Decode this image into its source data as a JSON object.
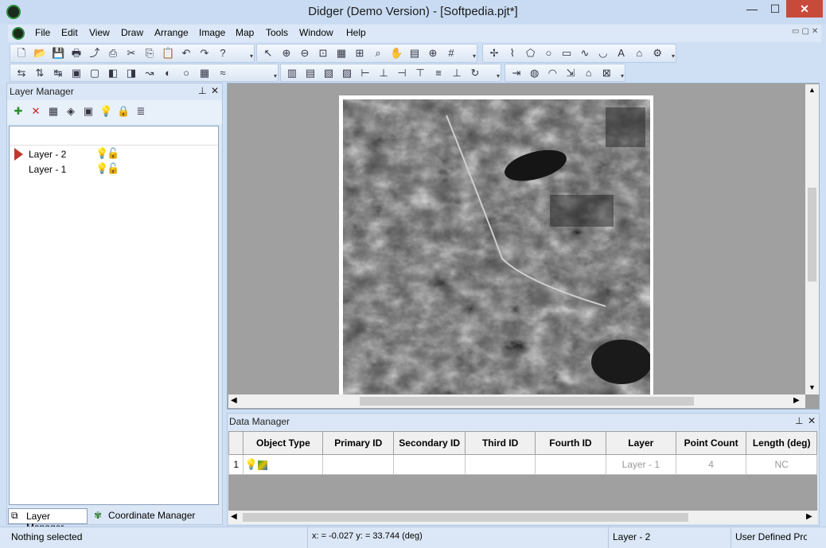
{
  "window": {
    "title": "Didger (Demo Version) - [Softpedia.pjt*]",
    "min_glyph": "—",
    "max_glyph": "☐",
    "close_glyph": "✕",
    "mdi_glyphs": "▭▢✕"
  },
  "menu": [
    "File",
    "Edit",
    "View",
    "Draw",
    "Arrange",
    "Image",
    "Map",
    "Tools",
    "Window",
    "Help"
  ],
  "toolbars": {
    "row1_left": [
      "new-file-icon",
      "open-folder-icon",
      "save-icon",
      "print-icon",
      "export-icon",
      "print-preview-icon",
      "cut-icon",
      "copy-icon",
      "paste-icon",
      "undo-icon",
      "redo-icon",
      "help-icon"
    ],
    "row1_right": [
      "select-arrow-icon",
      "zoom-in-icon",
      "zoom-out-icon",
      "zoom-rect-icon",
      "zoom-page-icon",
      "zoom-extents-icon",
      "zoom-selected-icon",
      "pan-hand-icon",
      "page-icon",
      "globe-grid-icon",
      "grid-icon"
    ],
    "row1_draw": [
      "point-icon",
      "polyline-icon",
      "polygon-icon",
      "ellipse-icon",
      "rectangle-icon",
      "spline-icon",
      "curve-icon",
      "text-icon",
      "house-icon",
      "symbol-icon"
    ],
    "row2_a": [
      "mirror-h-icon",
      "mirror-v-icon",
      "move-icon",
      "front-icon",
      "back-icon",
      "forward-icon",
      "backward-icon",
      "spline-smooth-icon",
      "fill-icon",
      "blank-icon",
      "hatch-icon",
      "wave-icon"
    ],
    "row2_b": [
      "align-icon-1",
      "align-icon-2",
      "align-icon-3",
      "align-icon-4",
      "align-left-icon",
      "align-center-icon",
      "align-right-icon",
      "align-top-icon",
      "align-middle-icon",
      "align-bottom-icon",
      "rotate-icon"
    ],
    "row2_c": [
      "transform-icon",
      "earth-icon",
      "projection-icon",
      "import-icon",
      "export-layer-icon",
      "georef-icon"
    ],
    "glyphs": {
      "new-file-icon": "🗋",
      "open-folder-icon": "📂",
      "save-icon": "💾",
      "print-icon": "🖶",
      "export-icon": "⤴",
      "print-preview-icon": "⎙",
      "cut-icon": "✂",
      "copy-icon": "⎘",
      "paste-icon": "📋",
      "undo-icon": "↶",
      "redo-icon": "↷",
      "help-icon": "?",
      "select-arrow-icon": "↖",
      "zoom-in-icon": "⊕",
      "zoom-out-icon": "⊖",
      "zoom-rect-icon": "⊡",
      "zoom-page-icon": "▦",
      "zoom-extents-icon": "⊞",
      "zoom-selected-icon": "⌕",
      "pan-hand-icon": "✋",
      "page-icon": "▤",
      "globe-grid-icon": "⊕",
      "grid-icon": "#",
      "point-icon": "✢",
      "polyline-icon": "⌇",
      "polygon-icon": "⬠",
      "ellipse-icon": "○",
      "rectangle-icon": "▭",
      "spline-icon": "∿",
      "curve-icon": "◡",
      "text-icon": "A",
      "house-icon": "⌂",
      "symbol-icon": "⚙",
      "mirror-h-icon": "⇆",
      "mirror-v-icon": "⇅",
      "move-icon": "↹",
      "front-icon": "▣",
      "back-icon": "▢",
      "forward-icon": "◧",
      "backward-icon": "◨",
      "spline-smooth-icon": "↝",
      "fill-icon": "◐",
      "blank-icon": "○",
      "hatch-icon": "▦",
      "wave-icon": "≈",
      "align-icon-1": "▥",
      "align-icon-2": "▤",
      "align-icon-3": "▧",
      "align-icon-4": "▨",
      "align-left-icon": "⊢",
      "align-center-icon": "⊥",
      "align-right-icon": "⊣",
      "align-top-icon": "⊤",
      "align-middle-icon": "≡",
      "align-bottom-icon": "⊥",
      "rotate-icon": "↻",
      "transform-icon": "⇥",
      "earth-icon": "◍",
      "projection-icon": "◠",
      "import-icon": "⇲",
      "export-layer-icon": "⌂",
      "georef-icon": "⊠"
    }
  },
  "layer_manager": {
    "title": "Layer Manager",
    "pin_glyph": "⊥",
    "close_glyph": "✕",
    "toolbar": [
      "add-layer-icon",
      "delete-layer-icon",
      "layer-props-icon",
      "layer-stack-icon",
      "layer-select-icon",
      "visibility-bulb-icon",
      "lock-icon",
      "layer-options-icon"
    ],
    "toolbar_glyphs": [
      "✚",
      "✕",
      "▦",
      "◈",
      "▣",
      "💡",
      "🔒",
      "≣"
    ],
    "layers": [
      {
        "name": "Layer - 2",
        "active": true
      },
      {
        "name": "Layer - 1",
        "active": false
      }
    ],
    "bulb_glyph": "💡",
    "lock_glyph": "🔓",
    "tabs": [
      "Layer Manager",
      "Coordinate Manager"
    ]
  },
  "data_manager": {
    "title": "Data Manager",
    "columns": [
      "Object Type",
      "Primary ID",
      "Secondary ID",
      "Third ID",
      "Fourth ID",
      "Layer",
      "Point Count",
      "Length (deg)"
    ],
    "rows": [
      {
        "num": "1",
        "object_type_icon": "polygon-object-icon",
        "primary_id": "",
        "secondary_id": "",
        "third_id": "",
        "fourth_id": "",
        "layer": "Layer - 1",
        "point_count": "4",
        "length": "NC"
      }
    ]
  },
  "status": {
    "selection": "Nothing selected",
    "coords": "x: = -0.027 y: = 33.744 (deg)",
    "layer": "Layer - 2",
    "projection": "User Defined Pro"
  },
  "colors": {
    "chrome": "#dbe7f6",
    "canvas": "#a0a0a0",
    "close_button": "#c74a3a",
    "active_layer_marker": "#c0392b"
  }
}
